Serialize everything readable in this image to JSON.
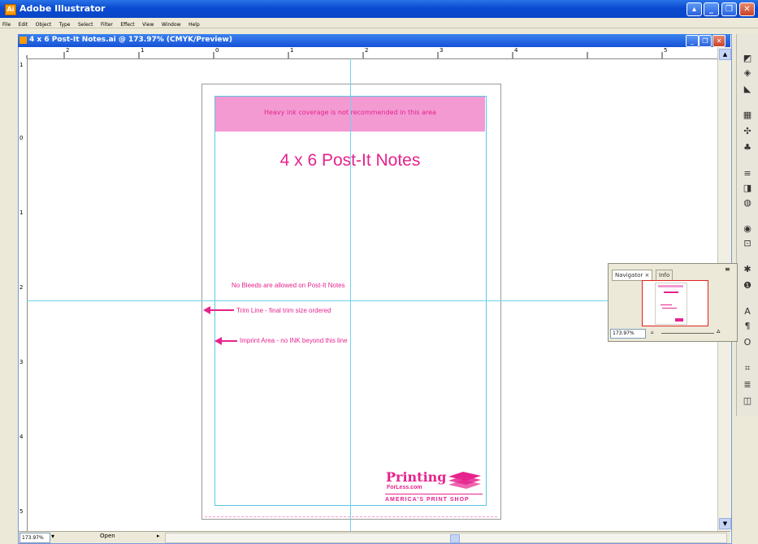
{
  "app": {
    "title": "Adobe Illustrator",
    "icon_label": "Ai"
  },
  "menu": [
    "File",
    "Edit",
    "Object",
    "Type",
    "Select",
    "Filter",
    "Effect",
    "View",
    "Window",
    "Help"
  ],
  "document": {
    "title": "4 x 6 Post-It Notes.ai @ 173.97% (CMYK/Preview)",
    "zoom": "173.97%",
    "status_text": "Open"
  },
  "artwork": {
    "ink_warning": "Heavy ink coverage is not recommended in this area",
    "heading": "4 x 6 Post-It Notes",
    "no_bleed": "No Bleeds are allowed on Post-It Notes",
    "trim_line": "Trim Line - final trim size ordered",
    "imprint_area": "Imprint Area - no INK beyond this line",
    "logo_name": "Printing",
    "logo_sub": "ForLess.com",
    "logo_tagline": "AMERICA'S PRINT SHOP",
    "accent_color": "#e6238d",
    "ink_band_color": "#f39ad2",
    "guide_color": "#6fd3ec"
  },
  "ruler": {
    "h_labels": [
      "2",
      "1",
      "0",
      "1",
      "2",
      "3",
      "4",
      "5"
    ],
    "v_labels": [
      "1",
      "0",
      "1",
      "2",
      "3",
      "4",
      "5"
    ]
  },
  "navigator": {
    "tabs": [
      "Navigator",
      "Info"
    ],
    "zoom": "173.97%"
  }
}
